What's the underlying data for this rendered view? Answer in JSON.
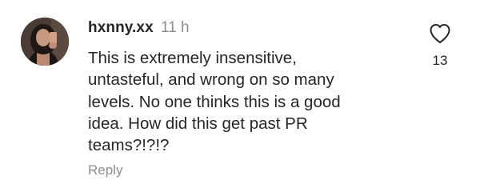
{
  "comment": {
    "username": "hxnny.xx",
    "time": "11 h",
    "text": "This is extremely insensitive,\nuntasteful, and wrong on so many\nlevels. No one thinks this is a good\nidea. How did this get past PR\nteams?!?!?",
    "reply_label": "Reply",
    "like_count": "13"
  },
  "icons": {
    "like": "heart-outline-icon",
    "avatar": "profile-photo"
  },
  "colors": {
    "text_primary": "#262626",
    "text_secondary": "#8e8e8e",
    "background": "#ffffff"
  }
}
